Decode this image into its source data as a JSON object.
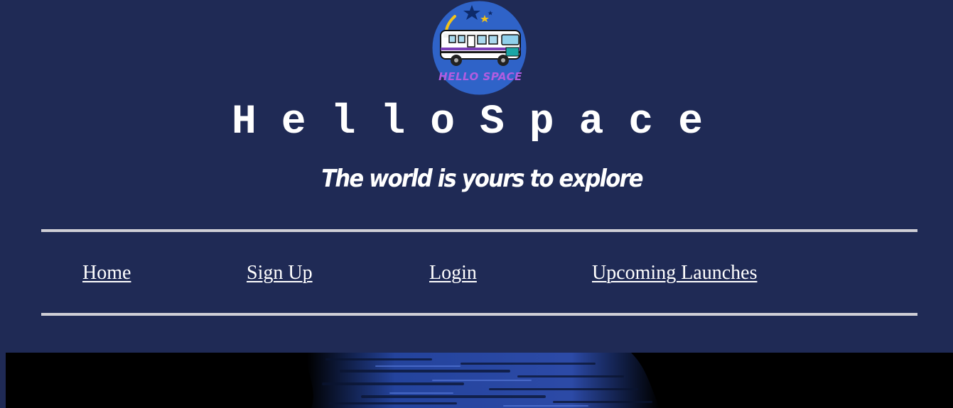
{
  "header": {
    "logo_text": "HELLO SPACE",
    "title": "HelloSpace",
    "tagline": "The world is yours to explore"
  },
  "nav": {
    "items": [
      {
        "label": "Home"
      },
      {
        "label": "Sign Up"
      },
      {
        "label": "Login"
      },
      {
        "label": "Upcoming Launches"
      }
    ]
  },
  "colors": {
    "background": "#1f2a55",
    "text": "#ffffff",
    "rule": "#cfcfd6",
    "hero_background": "#000000",
    "hero_accent": "#2a4fb8"
  },
  "icons": {
    "logo": "rv-van-space-logo"
  }
}
